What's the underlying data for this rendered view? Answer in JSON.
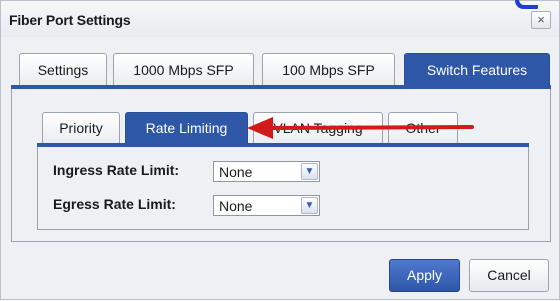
{
  "dialog": {
    "title": "Fiber Port Settings",
    "close_glyph": "×"
  },
  "tabs": [
    {
      "label": "Settings",
      "active": false
    },
    {
      "label": "1000 Mbps SFP",
      "active": false
    },
    {
      "label": "100 Mbps SFP",
      "active": false
    },
    {
      "label": "Switch Features",
      "active": true
    }
  ],
  "subtabs": [
    {
      "label": "Priority",
      "active": false
    },
    {
      "label": "Rate Limiting",
      "active": true
    },
    {
      "label": "VLAN Tagging",
      "active": false
    },
    {
      "label": "Other",
      "active": false
    }
  ],
  "fields": {
    "ingress": {
      "label": "Ingress Rate Limit:",
      "value": "None"
    },
    "egress": {
      "label": "Egress Rate Limit:",
      "value": "None"
    }
  },
  "buttons": {
    "apply": "Apply",
    "cancel": "Cancel"
  },
  "colors": {
    "accent": "#2f57a8",
    "annotation_arrow": "#d11a1a",
    "corner_mark": "#1f3fd0"
  },
  "icons": {
    "close": "close-icon",
    "dropdown": "chevron-down-icon",
    "annotation": "annotation-arrow"
  }
}
